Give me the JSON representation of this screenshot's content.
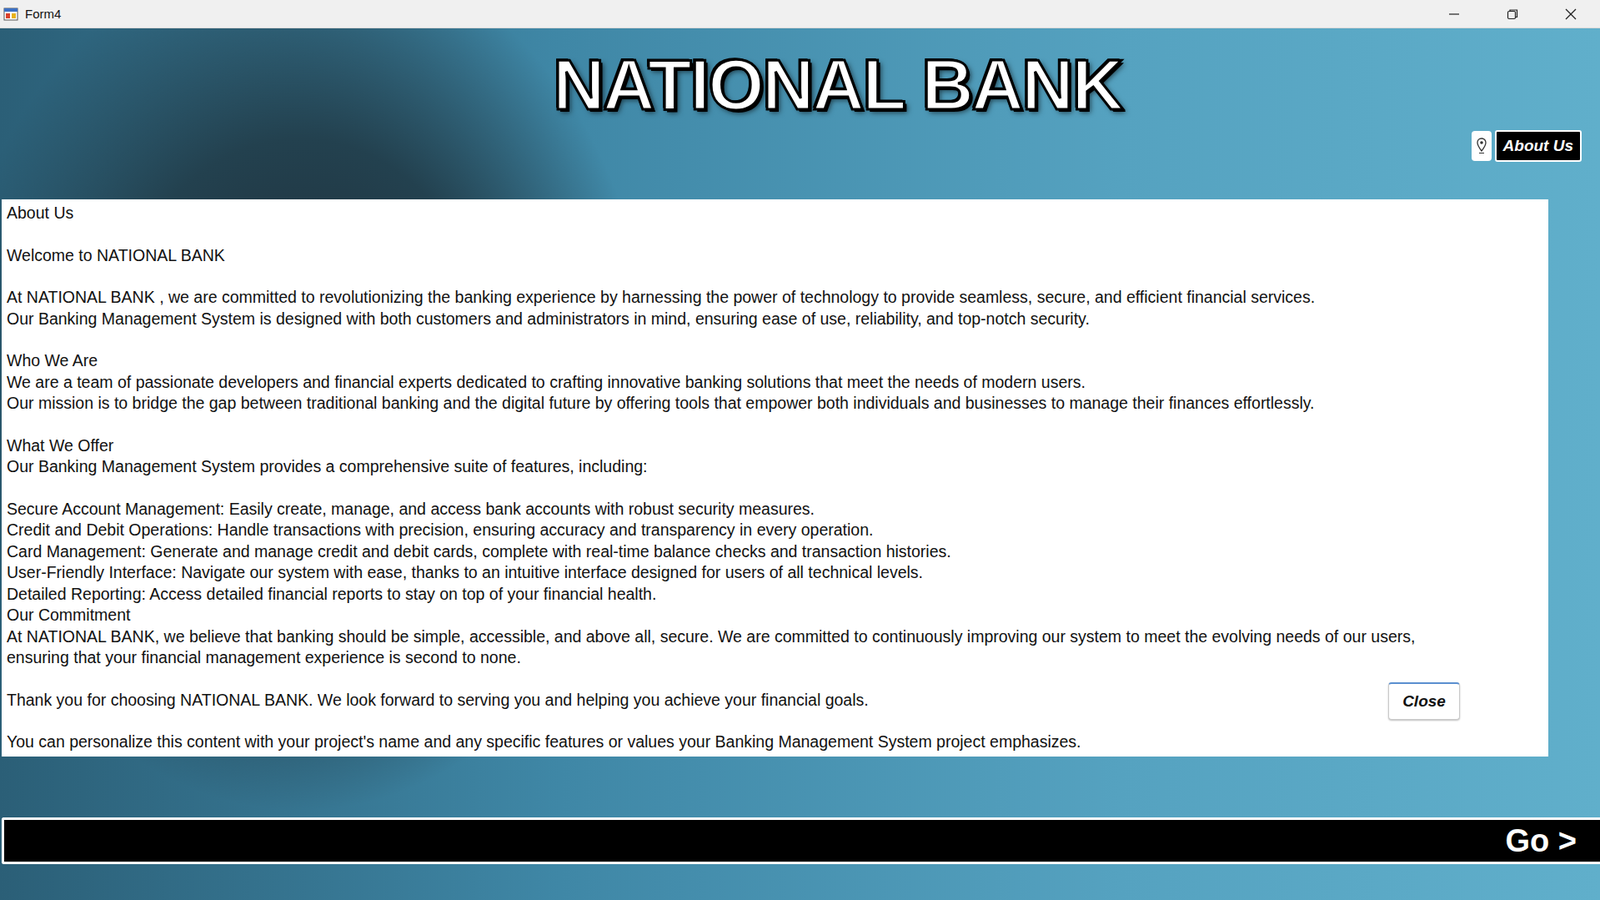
{
  "window": {
    "title": "Form4"
  },
  "logo": "NATIONAL BANK",
  "nav": {
    "about_button": "About Us"
  },
  "about_panel": {
    "blocks": [
      [
        "About Us"
      ],
      [
        "Welcome to NATIONAL BANK"
      ],
      [
        "At NATIONAL BANK , we are committed to revolutionizing the banking experience by harnessing the power of technology to provide seamless, secure, and efficient financial services.",
        "Our Banking Management System is designed with both customers and administrators in mind, ensuring ease of use, reliability, and top-notch security."
      ],
      [
        "Who We Are",
        "We are a team of passionate developers and financial experts dedicated to crafting innovative banking solutions that meet the needs of modern users.",
        "Our mission is to bridge the gap between traditional banking and the digital future by offering tools that empower both individuals and businesses to manage their finances effortlessly."
      ],
      [
        "What We Offer",
        "Our Banking Management System provides a comprehensive suite of features, including:"
      ],
      [
        "Secure Account Management: Easily create, manage, and access bank accounts with robust security measures.",
        "Credit and Debit Operations: Handle transactions with precision, ensuring accuracy and transparency in every operation.",
        "Card Management: Generate and manage credit and debit cards, complete with real-time balance checks and transaction histories.",
        "User-Friendly Interface: Navigate our system with ease, thanks to an intuitive interface designed for users of all technical levels.",
        "Detailed Reporting: Access detailed financial reports to stay on top of your financial health.",
        "Our Commitment",
        "At NATIONAL BANK, we believe that banking should be simple, accessible, and above all, secure. We are committed to continuously improving our system to meet the evolving needs of our users,",
        "ensuring that your financial management experience is second to none."
      ],
      [
        "Thank you for choosing NATIONAL BANK. We look forward to serving you and helping you achieve your financial goals."
      ],
      [
        "You can personalize this content with your project's name and any specific features or values your Banking Management System project emphasizes."
      ]
    ]
  },
  "close_button": "Close",
  "go_button": "Go >"
}
